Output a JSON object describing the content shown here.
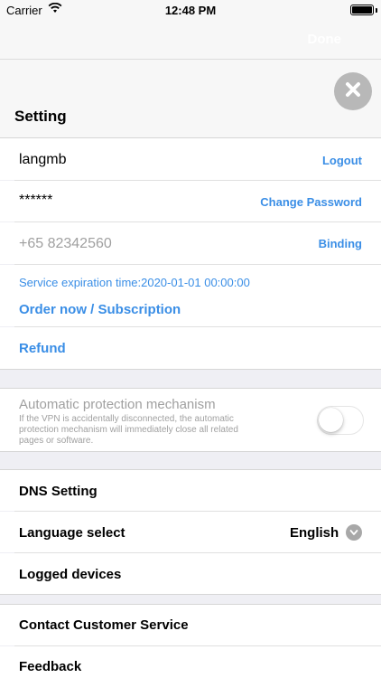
{
  "status_bar": {
    "carrier": "Carrier",
    "time": "12:48 PM"
  },
  "nav": {
    "done_label": "Done"
  },
  "header": {
    "title": "Setting",
    "close_icon": "close-x-icon"
  },
  "account": {
    "username": "langmb",
    "logout_label": "Logout",
    "password_mask": "******",
    "change_password_label": "Change Password",
    "phone": "+65 82342560",
    "binding_label": "Binding",
    "expiration_text": "Service expiration time:2020-01-01 00:00:00",
    "order_label": "Order now / Subscription",
    "refund_label": "Refund"
  },
  "protection": {
    "title": "Automatic protection mechanism",
    "description_line1": "If the VPN is accidentally disconnected, the automatic",
    "description_line2": "protection mechanism will immediately close all related",
    "description_line3": "pages or software.",
    "enabled": false
  },
  "settings": {
    "dns_label": "DNS Setting",
    "language_label": "Language select",
    "language_value": "English",
    "logged_devices_label": "Logged devices"
  },
  "support": {
    "contact_label": "Contact Customer Service",
    "feedback_label": "Feedback"
  },
  "colors": {
    "accent": "#3a8ee6",
    "background": "#efeff4",
    "placeholder": "#a0a0a0"
  }
}
